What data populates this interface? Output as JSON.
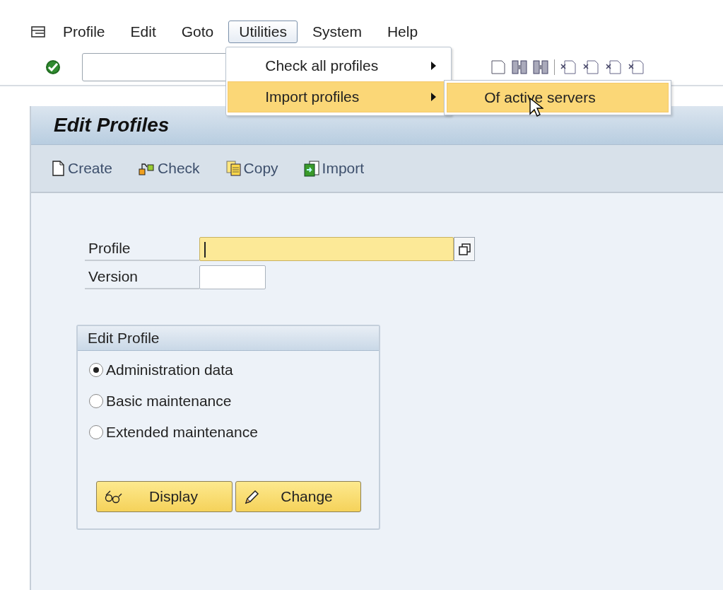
{
  "menu_bar": {
    "items": [
      {
        "label": "Profile",
        "selected": false
      },
      {
        "label": "Edit",
        "selected": false
      },
      {
        "label": "Goto",
        "selected": false
      },
      {
        "label": "Utilities",
        "selected": true,
        "menu": [
          {
            "label": "Check all profiles",
            "selected": false,
            "expanded": false
          },
          {
            "label": "Import profiles",
            "selected": true,
            "expanded": true,
            "submenu": [
              {
                "label": "Of active servers",
                "selected": true
              }
            ]
          }
        ]
      },
      {
        "label": "System",
        "selected": false
      },
      {
        "label": "Help",
        "selected": false
      }
    ]
  },
  "title": "Edit Profiles",
  "app_toolbar": [
    {
      "label": "Create",
      "kind": "create"
    },
    {
      "label": "Check",
      "kind": "check"
    },
    {
      "label": "Copy",
      "kind": "copy"
    },
    {
      "label": "Import",
      "kind": "import"
    }
  ],
  "fields": [
    {
      "label": "Profile",
      "kind": "search_help",
      "focused": true
    },
    {
      "label": "Version",
      "kind": "plain",
      "focused": false
    }
  ],
  "edit_profile": {
    "title": "Edit Profile",
    "options": [
      {
        "label": "Administration data",
        "selected": true
      },
      {
        "label": "Basic maintenance",
        "selected": false
      },
      {
        "label": "Extended maintenance",
        "selected": false
      }
    ],
    "buttons": [
      {
        "label": "Display",
        "kind": "display"
      },
      {
        "label": "Change",
        "kind": "change"
      }
    ]
  }
}
